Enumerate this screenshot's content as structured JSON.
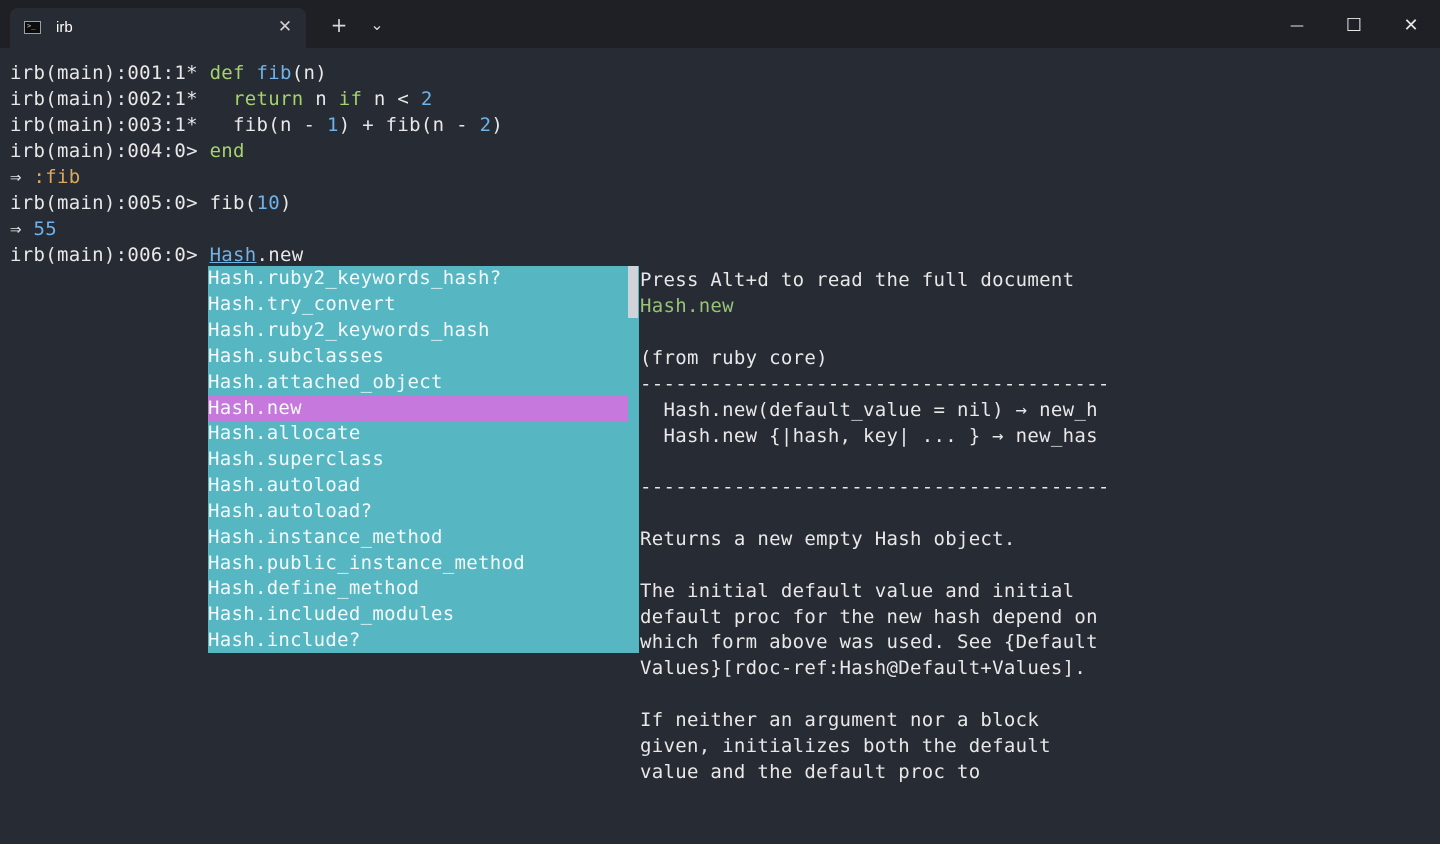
{
  "window": {
    "tab_title": "irb",
    "tab_icon": "terminal-icon",
    "new_tab_symbol": "+",
    "dropdown_symbol": "⌄",
    "close_tab_symbol": "✕",
    "minimize_symbol": "—",
    "maximize_symbol": "☐",
    "close_symbol": "✕"
  },
  "terminal": {
    "lines": [
      {
        "prompt": "irb(main):001:1* ",
        "kw": "def ",
        "fn": "fib",
        "rest": "(n)"
      },
      {
        "prompt": "irb(main):002:1*   ",
        "kw": "return",
        "rest": " n ",
        "kw2": "if",
        "rest2": " n < ",
        "num": "2"
      },
      {
        "prompt": "irb(main):003:1*   ",
        "rest": "fib(n - ",
        "num": "1",
        "rest2": ") + fib(n - ",
        "num2": "2",
        "rest3": ")"
      },
      {
        "prompt": "irb(main):004:0> ",
        "kw": "end"
      },
      {
        "arrow": "⇒ ",
        "sym": ":fib"
      },
      {
        "prompt": "irb(main):005:0> ",
        "rest": "fib(",
        "num": "10",
        "rest2": ")"
      },
      {
        "arrow": "⇒ ",
        "num": "55"
      },
      {
        "prompt": "irb(main):006:0> ",
        "ul": "Hash",
        "rest": ".new"
      }
    ]
  },
  "completion": {
    "items": [
      "Hash.ruby2_keywords_hash?",
      "Hash.try_convert",
      "Hash.ruby2_keywords_hash",
      "Hash.subclasses",
      "Hash.attached_object",
      "Hash.new",
      "Hash.allocate",
      "Hash.superclass",
      "Hash.autoload",
      "Hash.autoload?",
      "Hash.instance_method",
      "Hash.public_instance_method",
      "Hash.define_method",
      "Hash.included_modules",
      "Hash.include?"
    ],
    "selected": "Hash.new",
    "colors": {
      "menu_bg": "#56b6c2",
      "selected_bg": "#c678dd"
    }
  },
  "doc": {
    "lines": [
      "Press Alt+d to read the full document",
      "Hash.new",
      "",
      "(from ruby core)",
      "----------------------------------------",
      "  Hash.new(default_value = nil) → new_h",
      "  Hash.new {|hash, key| ... } → new_has",
      "",
      "----------------------------------------",
      "",
      "Returns a new empty Hash object.",
      "",
      "The initial default value and initial",
      "default proc for the new hash depend on",
      "which form above was used. See {Default",
      "Values}[rdoc-ref:Hash@Default+Values].",
      "",
      "If neither an argument nor a block",
      "given, initializes both the default",
      "value and the default proc to"
    ]
  }
}
